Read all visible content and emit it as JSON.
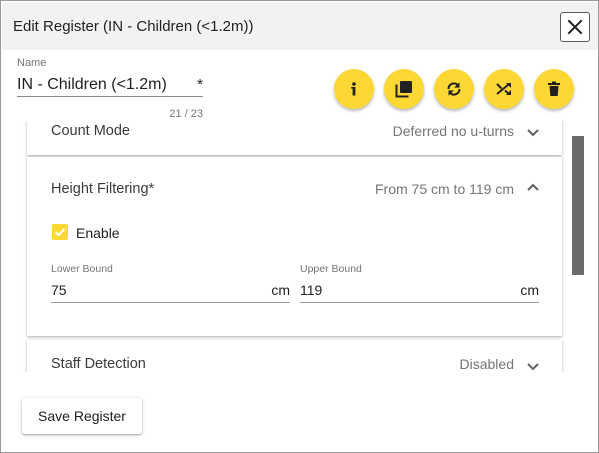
{
  "dialog": {
    "title": "Edit Register (IN - Children (<1.2m))",
    "close_icon": "close-icon"
  },
  "name_field": {
    "label": "Name",
    "value": "IN - Children (<1.2m)",
    "required_marker": "*",
    "counter": "21 / 23"
  },
  "actions": [
    {
      "name": "info-button",
      "icon": "info-icon"
    },
    {
      "name": "duplicate-button",
      "icon": "copy-icon"
    },
    {
      "name": "refresh-button",
      "icon": "sync-icon"
    },
    {
      "name": "shuffle-button",
      "icon": "shuffle-icon"
    },
    {
      "name": "delete-button",
      "icon": "trash-icon"
    }
  ],
  "panels": {
    "count_mode": {
      "title": "Count Mode",
      "summary": "Deferred no u-turns",
      "expanded": false
    },
    "height_filtering": {
      "title": "Height Filtering*",
      "summary": "From 75 cm to 119 cm",
      "expanded": true,
      "enable_label": "Enable",
      "enabled": true,
      "lower_bound": {
        "label": "Lower Bound",
        "value": "75",
        "unit": "cm"
      },
      "upper_bound": {
        "label": "Upper Bound",
        "value": "119",
        "unit": "cm"
      }
    },
    "staff_detection": {
      "title": "Staff Detection",
      "summary": "Disabled",
      "expanded": false
    }
  },
  "footer": {
    "save_label": "Save Register"
  },
  "colors": {
    "accent": "#fdd835",
    "title_bar": "#f2f2f2"
  }
}
